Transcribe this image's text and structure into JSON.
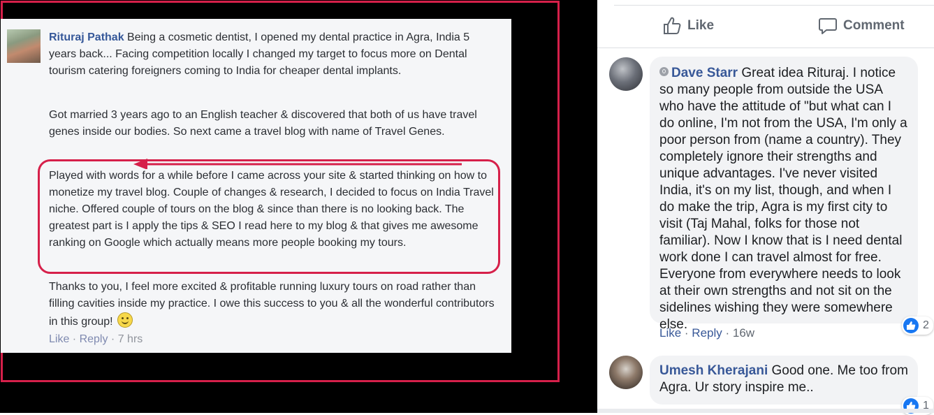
{
  "post": {
    "author": "Rituraj Pathak",
    "paragraph_1": "Being a cosmetic dentist, I opened my dental practice in Agra, India 5 years back... Facing competition locally I changed my target to focus more on Dental tourism catering foreigners coming to India for cheaper dental implants.",
    "paragraph_2": "Got married 3 years ago to an English teacher & discovered that both of us have travel genes inside our bodies. So next came a travel blog with name of Travel Genes.",
    "paragraph_3": "Played with words for a while before I came across your site & started thinking on how to monetize my travel blog. Couple of changes & research, I decided to focus on India Travel niche. Offered couple of tours on the blog & since than there is no looking back. The greatest part is I apply the tips & SEO I read here to my blog & that gives me awesome ranking on Google which actually means more people booking my tours.",
    "paragraph_4": "Thanks to you, I feel more excited & profitable running luxury tours on road rather than filling cavities inside my practice. I owe this success to you & all the wonderful contributors in this group!",
    "like_label": "Like",
    "reply_label": "Reply",
    "separator": " · ",
    "time": "7 hrs"
  },
  "toolbar": {
    "like_label": "Like",
    "comment_label": "Comment"
  },
  "comments": [
    {
      "author": "Dave Starr",
      "text": "Great idea Rituraj. I notice so many people from outside the USA who have the attitude of \"but what can I do online, I'm not from the USA, I'm only a poor person from (name a country). They completely ignore their strengths and unique advantages. I've never visited India, it's on my list, though, and when I do make the trip, Agra is my first city to visit (Taj Mahal, folks for those not familiar). Now I know that is I need dental work done I can travel almost for free. Everyone from everywhere needs to look at their own strengths and not sit on the sidelines wishing they were somewhere else.",
      "like_label": "Like",
      "reply_label": "Reply",
      "separator": " · ",
      "time": "16w",
      "reaction_count": "2"
    },
    {
      "author": "Umesh Kherajani",
      "text": "Good one. Me too from Agra. Ur story inspire me..",
      "reaction_count": "1"
    }
  ],
  "colors": {
    "highlight": "#d6204a",
    "author_link": "#385898",
    "like_blue": "#1877f2"
  },
  "icons": [
    "thumbs-up-icon",
    "speech-bubble-icon",
    "smiley-icon",
    "arrow-icon",
    "gray-dot-icon"
  ]
}
